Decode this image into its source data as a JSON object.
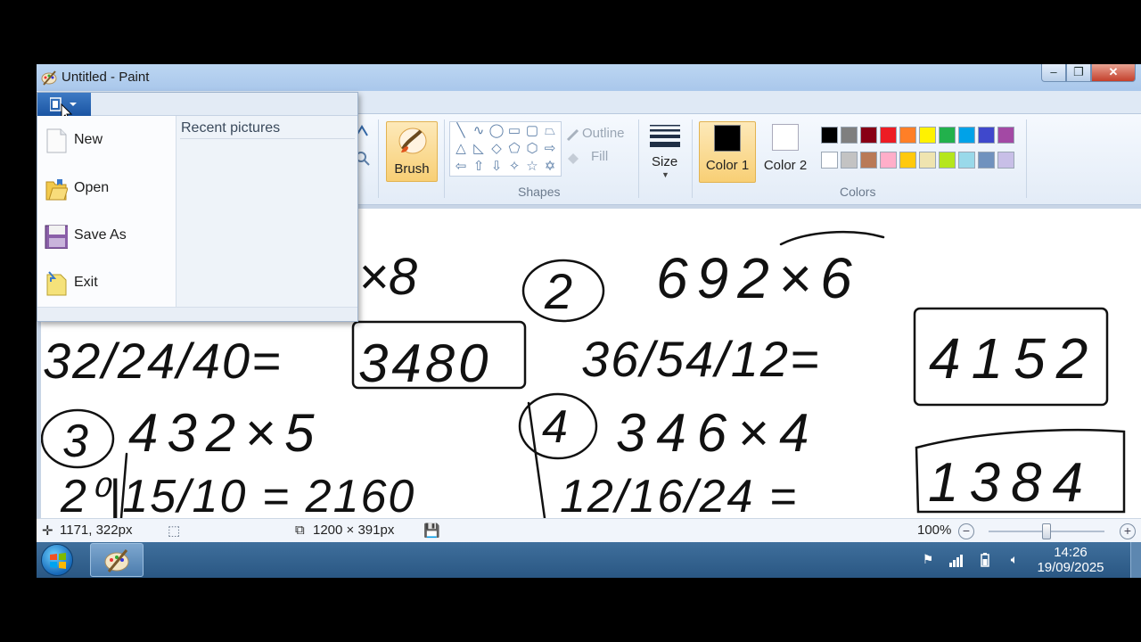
{
  "window": {
    "title": "Untitled - Paint",
    "controls": {
      "minimize": "–",
      "maximize": "❐",
      "close": "✕"
    }
  },
  "ribbon": {
    "brush_label": "Brush",
    "shapes_group_label": "Shapes",
    "outline_label": "Outline",
    "fill_label": "Fill",
    "size_label": "Size",
    "color1_label": "Color 1",
    "color2_label": "Color 2",
    "colors_group_label": "Colors",
    "color1_value": "#000000",
    "color2_value": "#ffffff",
    "palette_row1": [
      "#000000",
      "#7f7f7f",
      "#880015",
      "#ed1c24",
      "#ff7f27",
      "#fff200",
      "#22b14c",
      "#00a2e8",
      "#3f48cc",
      "#a349a4"
    ],
    "palette_row2": [
      "#ffffff",
      "#c3c3c3",
      "#b97a57",
      "#ffaec9",
      "#ffc90e",
      "#efe4b0",
      "#b5e61d",
      "#99d9ea",
      "#7092be",
      "#c8bfe7"
    ]
  },
  "file_menu": {
    "items": [
      {
        "label": "New",
        "icon": "new-page-icon"
      },
      {
        "label": "Open",
        "icon": "open-folder-icon"
      },
      {
        "label": "Save As",
        "icon": "save-as-icon"
      },
      {
        "label": "Exit",
        "icon": "exit-icon"
      }
    ],
    "recent_title": "Recent pictures"
  },
  "canvas": {
    "handwriting": {
      "line1": "×8",
      "circle2": "2",
      "problem2": "692×6",
      "work1": "32/24/40=",
      "answer1": "3480",
      "work2": "36/54/12=",
      "answer2": "4152",
      "circle3": "3",
      "problem3": "432×5",
      "circle4": "4",
      "problem4": "346×4",
      "work3": "2⁰|15/10 = 2160",
      "work4": "12/16/24 =",
      "answer4": "1384"
    }
  },
  "status_bar": {
    "cursor_pos": "1171, 322px",
    "image_size": "1200 × 391px",
    "zoom": "100%",
    "zoom_level": 0.5
  },
  "taskbar": {
    "time": "14:26",
    "date": "19/09/2025"
  }
}
